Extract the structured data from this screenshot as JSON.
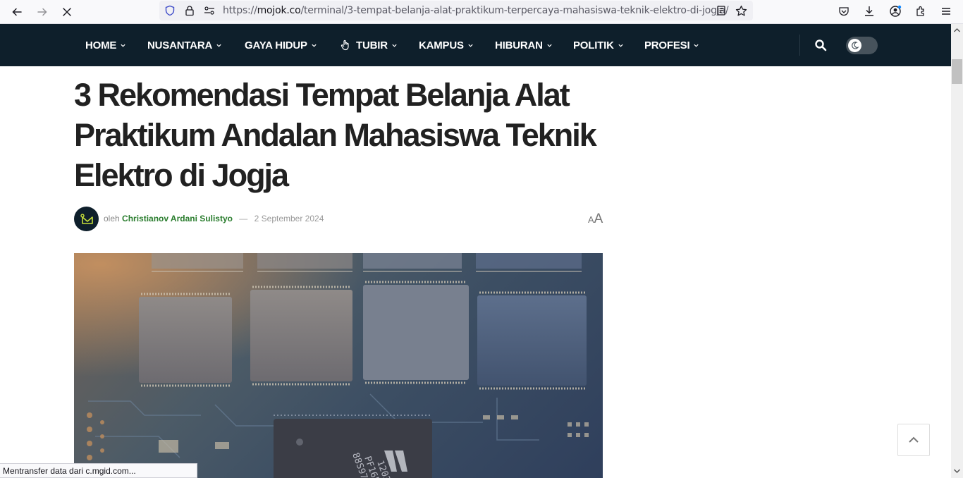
{
  "browser": {
    "url_domain": "mojok.co",
    "url_prefix": "https://",
    "url_path": "/terminal/3-tempat-belanja-alat-praktikum-terpercaya-mahasiswa-teknik-elektro-di-jogja/",
    "status_text": "Mentransfer data dari c.mgid.com..."
  },
  "nav": {
    "items": [
      {
        "label": "HOME"
      },
      {
        "label": "NUSANTARA"
      },
      {
        "label": "GAYA HIDUP"
      },
      {
        "label": "TUBIR"
      },
      {
        "label": "KAMPUS"
      },
      {
        "label": "HIBURAN"
      },
      {
        "label": "POLITIK"
      },
      {
        "label": "PROFESI"
      }
    ],
    "background": "#0e1f2b"
  },
  "article": {
    "title": "3 Rekomendasi Tempat Belanja Alat Praktikum Andalan Mahasiswa Teknik Elektro di Jogja",
    "by_prefix": "oleh",
    "author": "Christianov Ardani Sulistyo",
    "separator": "—",
    "date": "2 September 2024",
    "font_small": "A",
    "font_big": "A",
    "accent": "#2a7d2e"
  },
  "icons": [
    "back-arrow-icon",
    "forward-arrow-icon",
    "stop-icon",
    "shield-icon",
    "lock-icon",
    "permissions-icon",
    "reader-view-icon",
    "bookmark-star-icon",
    "pocket-icon",
    "download-icon",
    "account-icon",
    "extensions-icon",
    "menu-icon",
    "chevron-down-icon",
    "hand-pointer-icon",
    "search-icon",
    "moon-icon",
    "chevron-up-icon"
  ]
}
